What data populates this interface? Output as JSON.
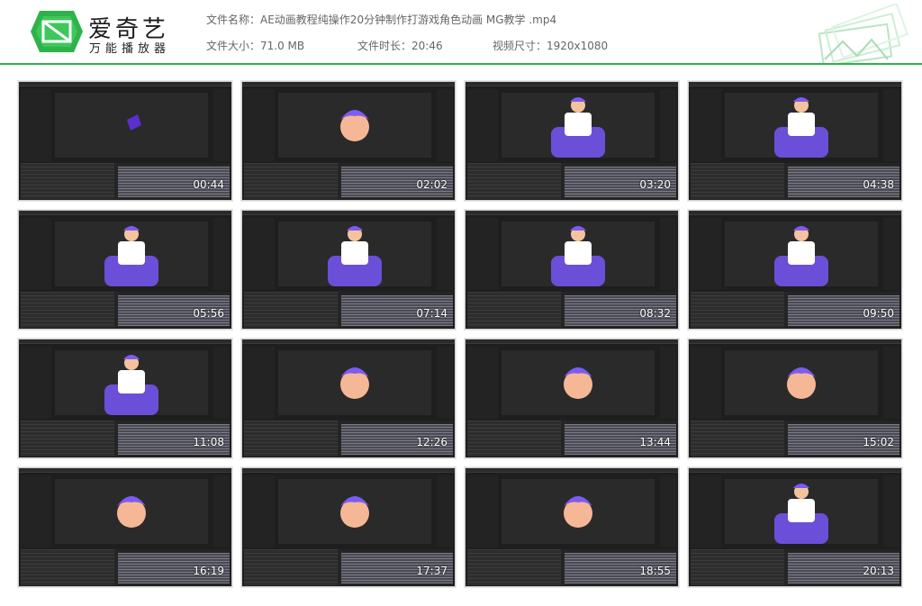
{
  "app": {
    "logo_title": "爱奇艺",
    "logo_subtitle": "万能播放器",
    "brand_color": "#2db34a",
    "logo_icon": "iqiyi-logo-icon"
  },
  "file_info": {
    "name_label": "文件名称：",
    "name_value": "AE动画教程纯操作20分钟制作打游戏角色动画 MG教学 .mp4",
    "size_label": "文件大小：",
    "size_value": "71.0 MB",
    "duration_label": "文件时长：",
    "duration_value": "20:46",
    "dimension_label": "视频尺寸：",
    "dimension_value": "1920x1080"
  },
  "thumbnails": [
    {
      "time": "00:44",
      "scene": "black"
    },
    {
      "time": "02:02",
      "scene": "check"
    },
    {
      "time": "03:20",
      "scene": "cream"
    },
    {
      "time": "04:38",
      "scene": "cream"
    },
    {
      "time": "05:56",
      "scene": "cream"
    },
    {
      "time": "07:14",
      "scene": "cream"
    },
    {
      "time": "08:32",
      "scene": "cream"
    },
    {
      "time": "09:50",
      "scene": "cream"
    },
    {
      "time": "11:08",
      "scene": "cream"
    },
    {
      "time": "12:26",
      "scene": "check"
    },
    {
      "time": "13:44",
      "scene": "check"
    },
    {
      "time": "15:02",
      "scene": "check"
    },
    {
      "time": "16:19",
      "scene": "check"
    },
    {
      "time": "17:37",
      "scene": "check"
    },
    {
      "time": "18:55",
      "scene": "check"
    },
    {
      "time": "20:13",
      "scene": "cream"
    }
  ]
}
